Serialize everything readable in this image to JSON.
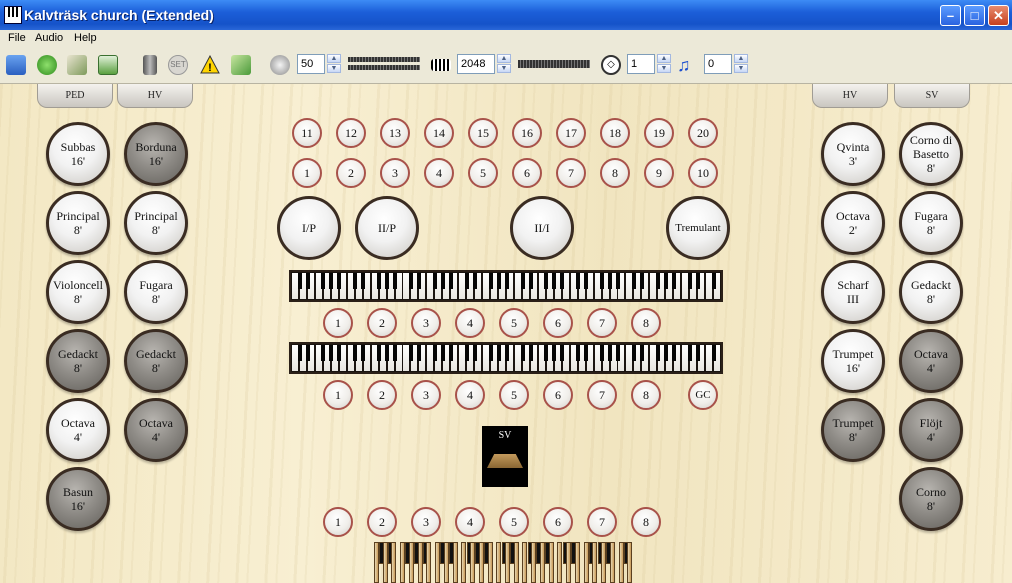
{
  "window": {
    "title": "Kalvträsk church (Extended)"
  },
  "menu": [
    "File",
    "Audio",
    "Help"
  ],
  "toolbar": {
    "volume": "50",
    "polyphony": "2048",
    "transpose": "1",
    "midi_channel": "0"
  },
  "tabs": {
    "left_1": "PED",
    "left_2": "HV",
    "right_1": "HV",
    "right_2": "SV"
  },
  "stops": {
    "ped": [
      {
        "label": "Subbas\n16'",
        "on": true
      },
      {
        "label": "Principal\n8'",
        "on": true
      },
      {
        "label": "Violoncell\n8'",
        "on": true
      },
      {
        "label": "Gedackt\n8'",
        "on": false
      },
      {
        "label": "Octava\n4'",
        "on": true
      },
      {
        "label": "Basun\n16'",
        "on": false
      }
    ],
    "hv_left": [
      {
        "label": "Borduna\n16'",
        "on": false
      },
      {
        "label": "Principal\n8'",
        "on": true
      },
      {
        "label": "Fugara\n8'",
        "on": true
      },
      {
        "label": "Gedackt\n8'",
        "on": false
      },
      {
        "label": "Octava\n4'",
        "on": false
      }
    ],
    "hv_right": [
      {
        "label": "Qvinta\n3'",
        "on": true
      },
      {
        "label": "Octava\n2'",
        "on": true
      },
      {
        "label": "Scharf\nIII",
        "on": true
      },
      {
        "label": "Trumpet\n16'",
        "on": true
      },
      {
        "label": "Trumpet\n8'",
        "on": false
      }
    ],
    "sv": [
      {
        "label": "Corno di\nBasetto\n8'",
        "on": true
      },
      {
        "label": "Fugara\n8'",
        "on": true
      },
      {
        "label": "Gedackt\n8'",
        "on": true
      },
      {
        "label": "Octava\n4'",
        "on": false
      },
      {
        "label": "Flöjt\n4'",
        "on": false
      },
      {
        "label": "Corno\n8'",
        "on": false
      }
    ]
  },
  "general_pistons_top": [
    "11",
    "12",
    "13",
    "14",
    "15",
    "16",
    "17",
    "18",
    "19",
    "20"
  ],
  "general_pistons_bottom": [
    "1",
    "2",
    "3",
    "4",
    "5",
    "6",
    "7",
    "8",
    "9",
    "10"
  ],
  "couplers": [
    "I/P",
    "II/P",
    "II/I",
    "Tremulant"
  ],
  "manual_2_pistons": [
    "1",
    "2",
    "3",
    "4",
    "5",
    "6",
    "7",
    "8"
  ],
  "manual_1_pistons": [
    "1",
    "2",
    "3",
    "4",
    "5",
    "6",
    "7",
    "8"
  ],
  "general_cancel": "GC",
  "swell_label": "SV",
  "pedal_pistons": [
    "1",
    "2",
    "3",
    "4",
    "5",
    "6",
    "7",
    "8"
  ]
}
